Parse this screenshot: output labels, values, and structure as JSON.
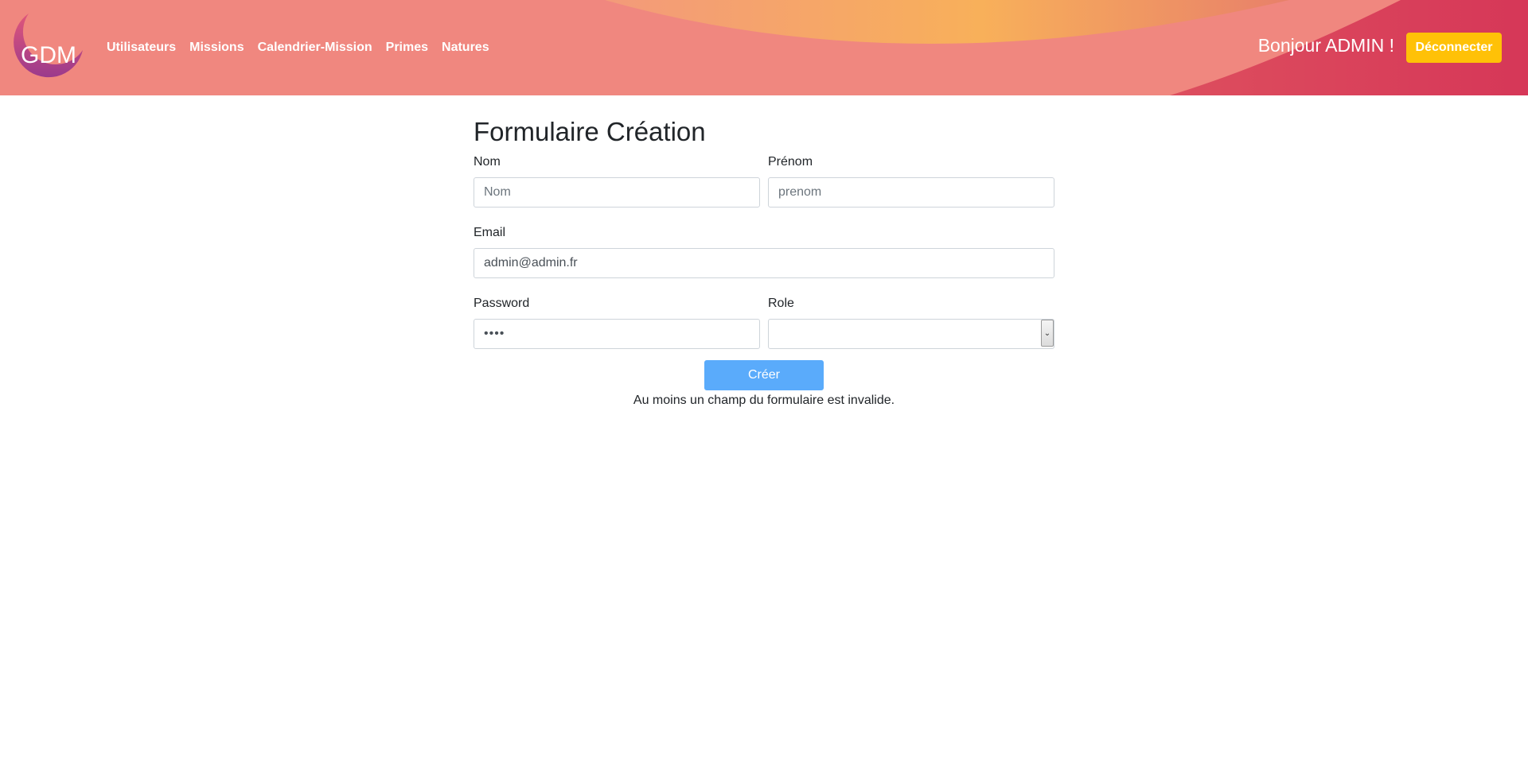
{
  "header": {
    "logo_text": "GDM",
    "nav": [
      {
        "label": "Utilisateurs"
      },
      {
        "label": "Missions"
      },
      {
        "label": "Calendrier-Mission"
      },
      {
        "label": "Primes"
      },
      {
        "label": "Natures"
      }
    ],
    "greeting": "Bonjour ADMIN !",
    "logout_label": "Déconnecter",
    "colors": {
      "banner_pink": "#f0877f",
      "banner_orange": "#f8b05a",
      "banner_crimson": "#d6395a",
      "logout_button": "#ffc107"
    }
  },
  "form": {
    "title": "Formulaire Création",
    "nom": {
      "label": "Nom",
      "placeholder": "Nom",
      "value": ""
    },
    "prenom": {
      "label": "Prénom",
      "placeholder": "prenom",
      "value": ""
    },
    "email": {
      "label": "Email",
      "placeholder": "",
      "value": "admin@admin.fr"
    },
    "password": {
      "label": "Password",
      "value": "••••"
    },
    "role": {
      "label": "Role",
      "selected": ""
    },
    "submit_label": "Créer",
    "error_message": "Au moins un champ du formulaire est invalide.",
    "colors": {
      "submit_button": "#5aabfb"
    }
  }
}
